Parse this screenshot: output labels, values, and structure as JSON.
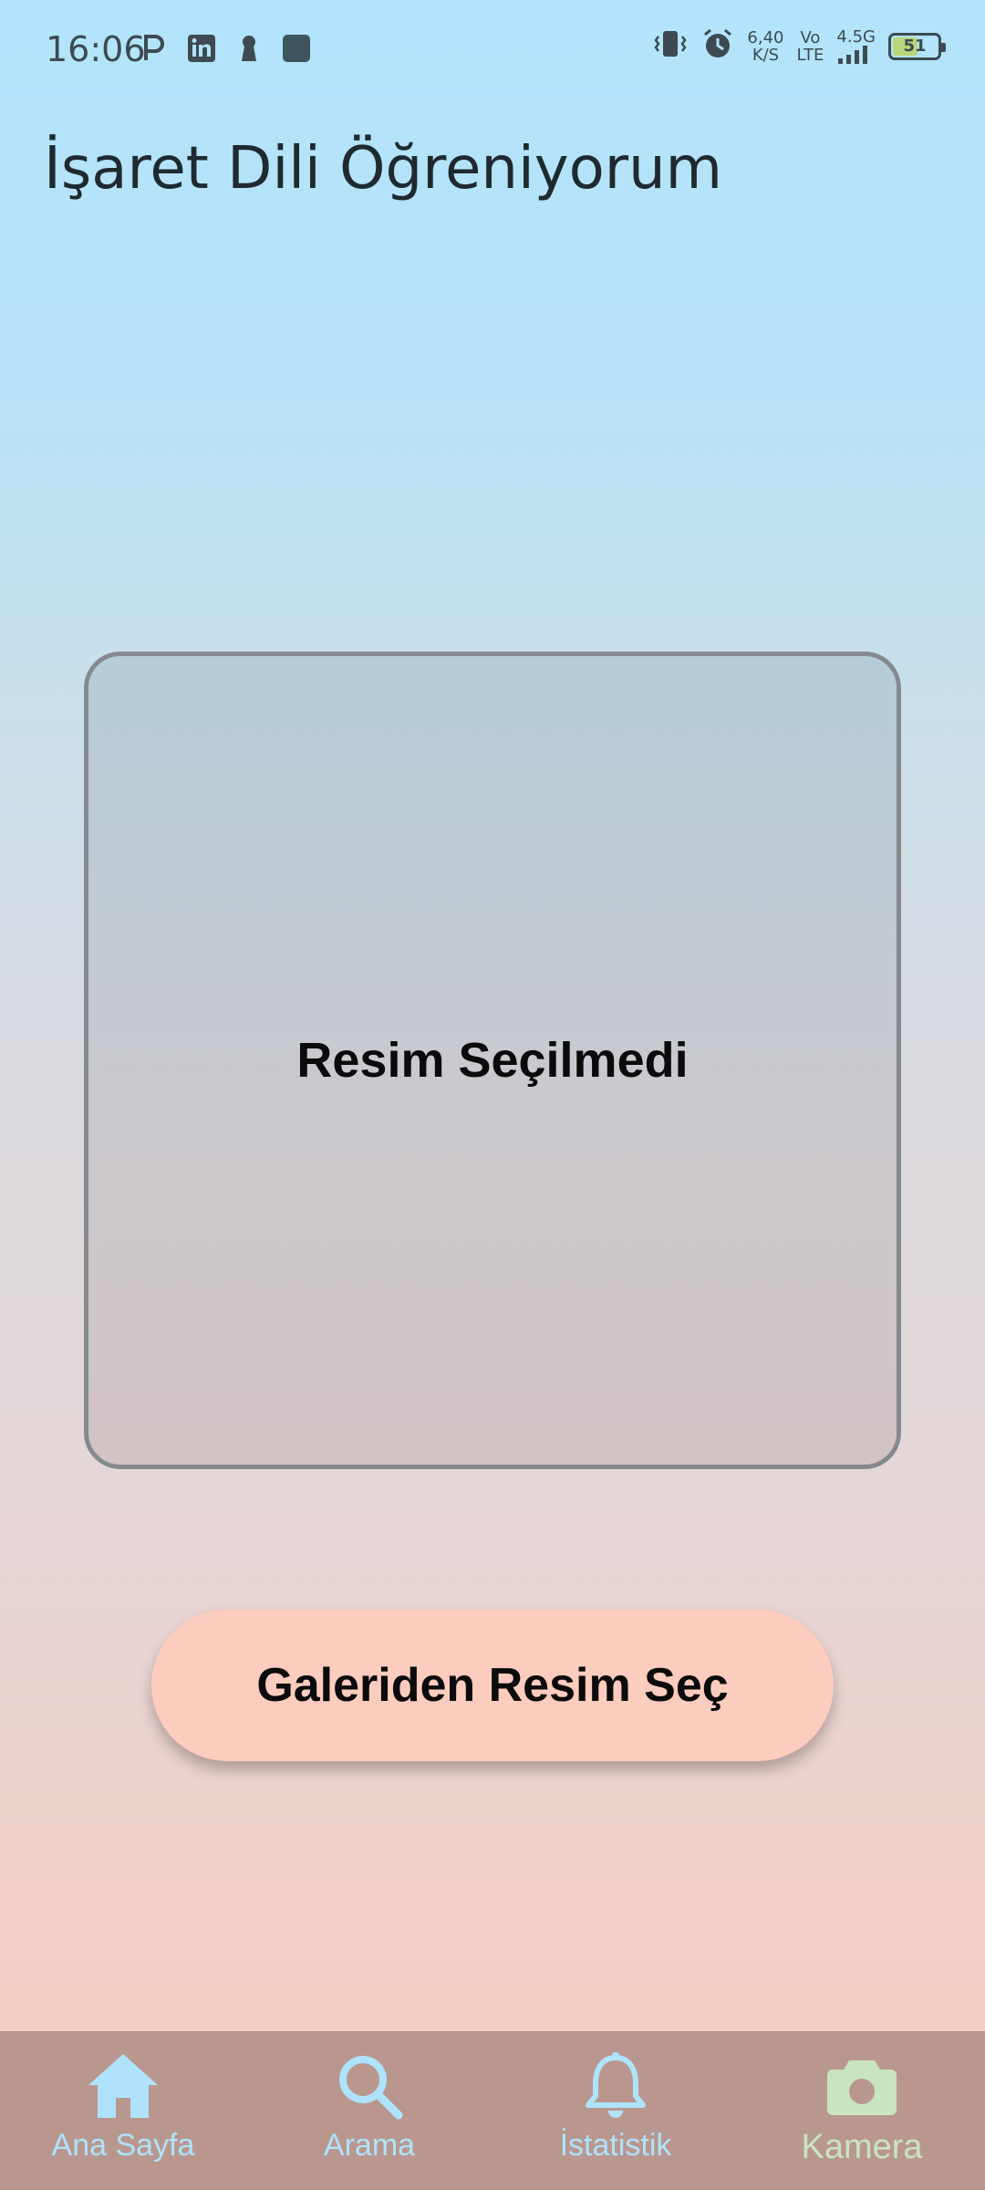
{
  "status_bar": {
    "time": "16:06",
    "net_speed_value": "6,40",
    "net_speed_unit": "K/S",
    "volte_top": "Vo",
    "volte_bottom": "LTE",
    "network": "4.5G",
    "battery": "51"
  },
  "app": {
    "title": "İşaret Dili Öğreniyorum"
  },
  "image_area": {
    "placeholder": "Resim Seçilmedi"
  },
  "actions": {
    "pick_from_gallery": "Galeriden Resim Seç"
  },
  "bottom_nav": {
    "items": [
      {
        "label": "Ana Sayfa",
        "icon": "home-icon"
      },
      {
        "label": "Arama",
        "icon": "search-icon"
      },
      {
        "label": "İstatistik",
        "icon": "bell-icon"
      },
      {
        "label": "Kamera",
        "icon": "camera-icon",
        "active": true
      }
    ]
  },
  "colors": {
    "nav_background": "#b9978f",
    "nav_item": "#aee3fb",
    "nav_active": "#c8e5bf",
    "button": "#fcccbe"
  }
}
